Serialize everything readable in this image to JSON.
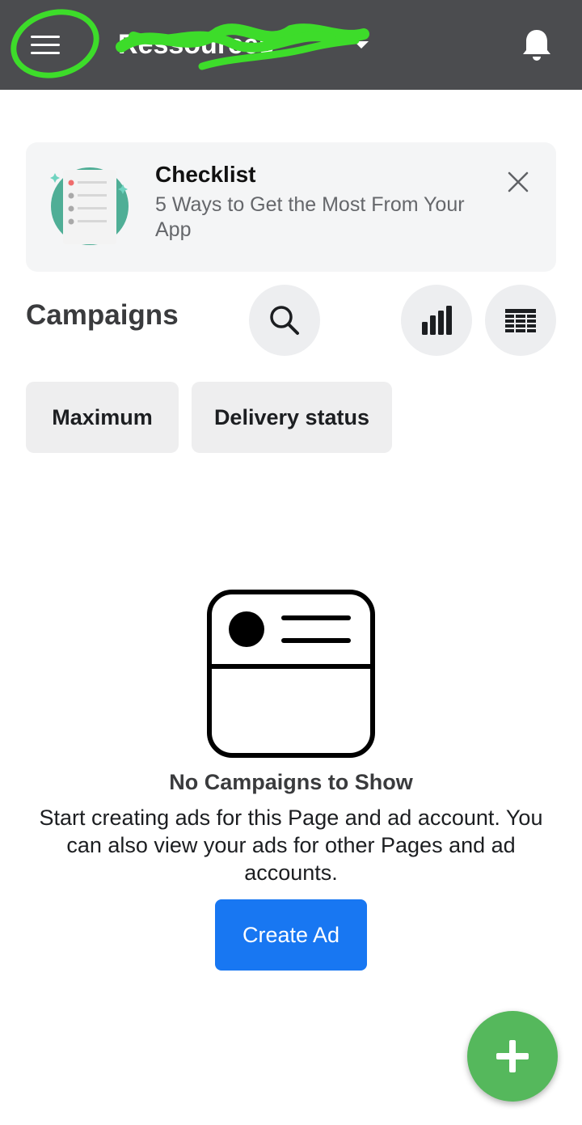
{
  "header": {
    "account_name": "Ressources",
    "icons": [
      "menu-icon",
      "caret-down-icon",
      "bell-icon"
    ],
    "background": "#4b4c4f"
  },
  "checklist": {
    "title": "Checklist",
    "subtitle": "5 Ways to Get the Most From Your App",
    "icons": [
      "checklist-illustration",
      "close-icon"
    ]
  },
  "campaigns": {
    "title": "Campaigns",
    "icons": [
      "search-icon",
      "bar-chart-icon",
      "table-icon"
    ]
  },
  "filters": {
    "maximum_label": "Maximum",
    "delivery_label": "Delivery status"
  },
  "empty_state": {
    "title": "No Campaigns to Show",
    "description": "Start creating ads for this Page and ad account. You can also view your ads for other Pages and ad accounts.",
    "button_label": "Create Ad",
    "icon": "empty-campaign-icon"
  },
  "fab": {
    "icon": "plus-icon",
    "color": "#55b85c"
  },
  "colors": {
    "primary": "#1877f2",
    "annotation": "#3ddc2a"
  }
}
